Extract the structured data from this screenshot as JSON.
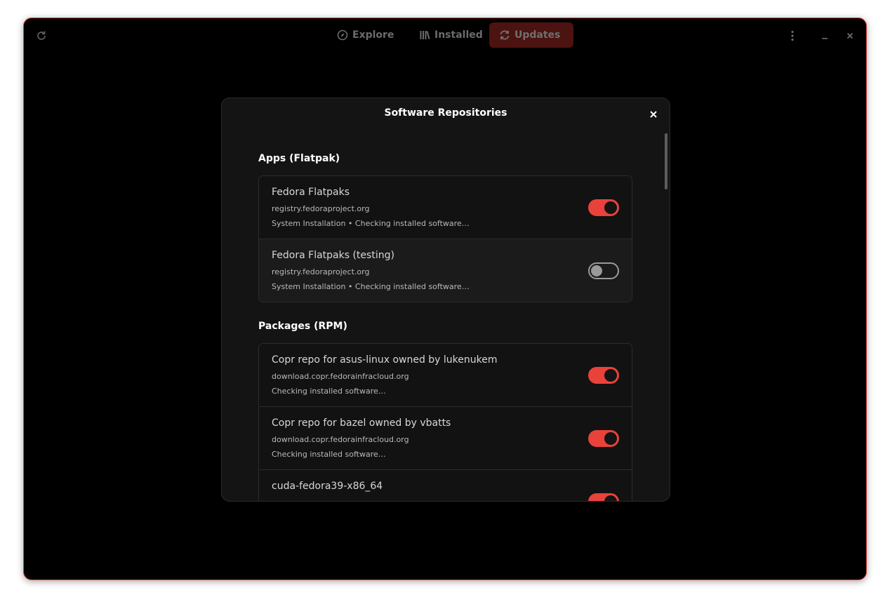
{
  "header": {
    "tabs": [
      {
        "label": "Explore",
        "icon": "compass-icon"
      },
      {
        "label": "Installed",
        "icon": "library-icon"
      },
      {
        "label": "Updates",
        "icon": "refresh-icon",
        "selected": true
      }
    ]
  },
  "dialog": {
    "title": "Software Repositories",
    "sections": [
      {
        "title": "Apps (Flatpak)",
        "rows": [
          {
            "name": "Fedora Flatpaks",
            "url": "registry.fedoraproject.org",
            "detail": "System Installation • Checking installed software…",
            "enabled": true
          },
          {
            "name": "Fedora Flatpaks (testing)",
            "url": "registry.fedoraproject.org",
            "detail": "System Installation • Checking installed software…",
            "enabled": false
          }
        ]
      },
      {
        "title": "Packages (RPM)",
        "rows": [
          {
            "name": "Copr repo for asus-linux owned by lukenukem",
            "url": "download.copr.fedorainfracloud.org",
            "detail": "Checking installed software…",
            "enabled": true
          },
          {
            "name": "Copr repo for bazel owned by vbatts",
            "url": "download.copr.fedorainfracloud.org",
            "detail": "Checking installed software…",
            "enabled": true
          },
          {
            "name": "cuda-fedora39-x86_64",
            "url": "",
            "detail": "",
            "enabled": true
          }
        ]
      }
    ]
  },
  "colors": {
    "accent": "#e9423b",
    "window_border": "#e0463a",
    "selected_tab_bg": "#4c1310"
  }
}
